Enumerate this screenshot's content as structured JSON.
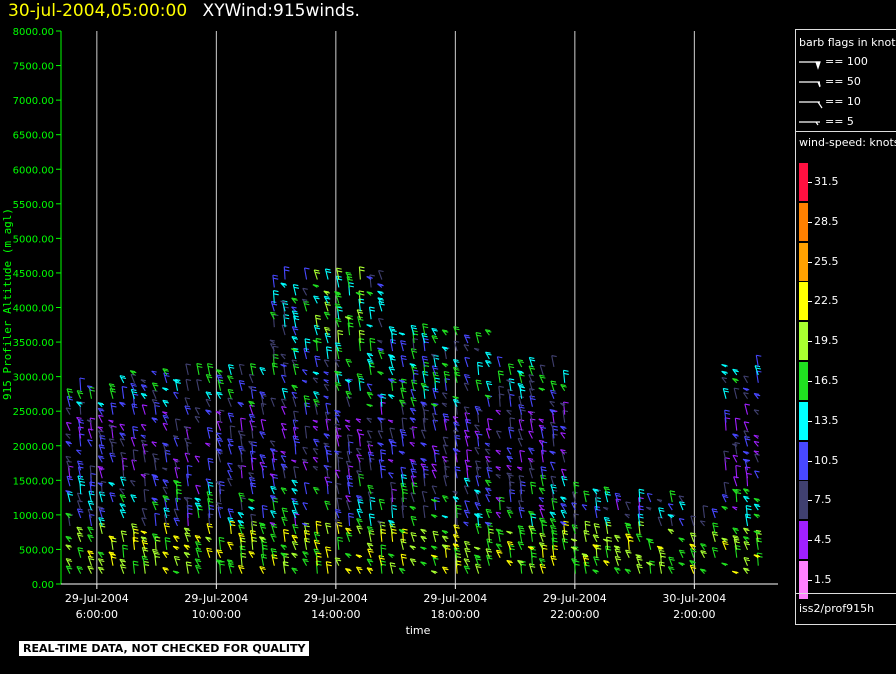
{
  "header": {
    "datetime": "30-jul-2004,05:00:00",
    "product": "XYWind:915winds."
  },
  "colors": {
    "accent_title": "#ffff00",
    "axis_y": "#00ff00",
    "axis": "#ffffff"
  },
  "chart_data": {
    "type": "wind-barb time-height",
    "title": "",
    "xlabel": "time",
    "ylabel": "915 Profiler Altitude (m agl)",
    "ylim": [
      0,
      8000
    ],
    "y_ticks": [
      "0.00",
      "500.00",
      "1000.00",
      "1500.00",
      "2000.00",
      "2500.00",
      "3000.00",
      "3500.00",
      "4000.00",
      "4500.00",
      "5000.00",
      "5500.00",
      "6000.00",
      "6500.00",
      "7000.00",
      "7500.00",
      "8000.00"
    ],
    "x_ticks": [
      {
        "date": "29-Jul-2004",
        "time": "6:00:00"
      },
      {
        "date": "29-Jul-2004",
        "time": "10:00:00"
      },
      {
        "date": "29-Jul-2004",
        "time": "14:00:00"
      },
      {
        "date": "29-Jul-2004",
        "time": "18:00:00"
      },
      {
        "date": "29-Jul-2004",
        "time": "22:00:00"
      },
      {
        "date": "30-Jul-2004",
        "time": "2:00:00"
      }
    ],
    "xlim_hours_since_start": [
      0,
      24
    ],
    "grid_vertical": true,
    "barb_flags_title": "barb flags in knots",
    "barb_flags": [
      "== 100",
      "== 50",
      "== 10",
      "== 5"
    ],
    "colorbar_title": "wind-speed: knots",
    "colorbar": [
      {
        "label": "31.5",
        "color": "#ff1040"
      },
      {
        "label": "28.5",
        "color": "#ff8000"
      },
      {
        "label": "25.5",
        "color": "#ffa000"
      },
      {
        "label": "22.5",
        "color": "#ffff00"
      },
      {
        "label": "19.5",
        "color": "#a8ff30"
      },
      {
        "label": "16.5",
        "color": "#20e020"
      },
      {
        "label": "13.5",
        "color": "#00ffff"
      },
      {
        "label": "10.5",
        "color": "#4848ff"
      },
      {
        "label": "7.5",
        "color": "#404070"
      },
      {
        "label": "4.5",
        "color": "#a020ff"
      },
      {
        "label": "1.5",
        "color": "#ff80ff"
      }
    ],
    "station": "iss2/prof915h"
  },
  "footer": {
    "qc_note": "REAL-TIME DATA, NOT CHECKED FOR QUALITY"
  }
}
